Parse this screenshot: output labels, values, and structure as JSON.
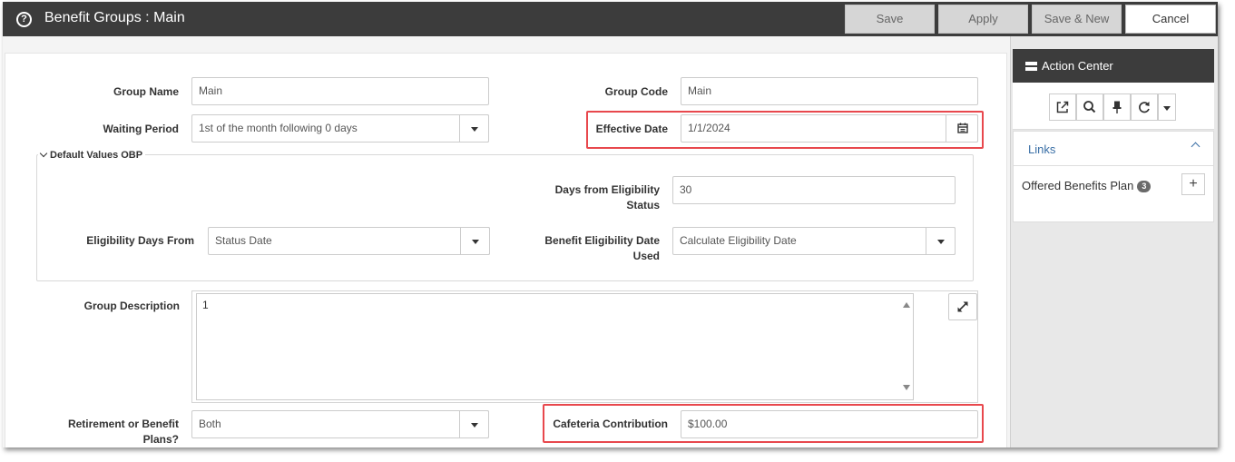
{
  "window": {
    "title": "Benefit Groups : Main",
    "help_icon": "question-circle-icon"
  },
  "toolbar": {
    "save_label": "Save",
    "apply_label": "Apply",
    "save_new_label": "Save & New",
    "cancel_label": "Cancel"
  },
  "form": {
    "group_name_label": "Group Name",
    "group_name_value": "Main",
    "group_code_label": "Group Code",
    "group_code_value": "Main",
    "waiting_period_label": "Waiting Period",
    "waiting_period_value": "1st of the month following 0 days",
    "effective_date_label": "Effective Date",
    "effective_date_value": "1/1/2024",
    "default_values_legend": "Default Values OBP",
    "days_from_eligibility_label_1": "Days from Eligibility",
    "days_from_eligibility_label_2": "Status",
    "days_from_eligibility_value": "30",
    "eligibility_days_from_label": "Eligibility Days From",
    "eligibility_days_from_value": "Status Date",
    "benefit_eligibility_date_label_1": "Benefit Eligibility Date",
    "benefit_eligibility_date_label_2": "Used",
    "benefit_eligibility_date_value": "Calculate Eligibility Date",
    "group_description_label": "Group Description",
    "group_description_value": "1",
    "retirement_label_1": "Retirement or Benefit",
    "retirement_label_2": "Plans?",
    "retirement_value": "Both",
    "cafeteria_label": "Cafeteria Contribution",
    "cafeteria_value": "$100.00"
  },
  "highlight_color": "#e8484d",
  "action_center": {
    "title": "Action Center",
    "tools": [
      "external-link-icon",
      "search-icon",
      "pin-icon",
      "refresh-icon",
      "caret-down-icon"
    ],
    "links_title": "Links",
    "links": [
      {
        "label": "Offered Benefits Plan",
        "count": "3"
      }
    ]
  }
}
